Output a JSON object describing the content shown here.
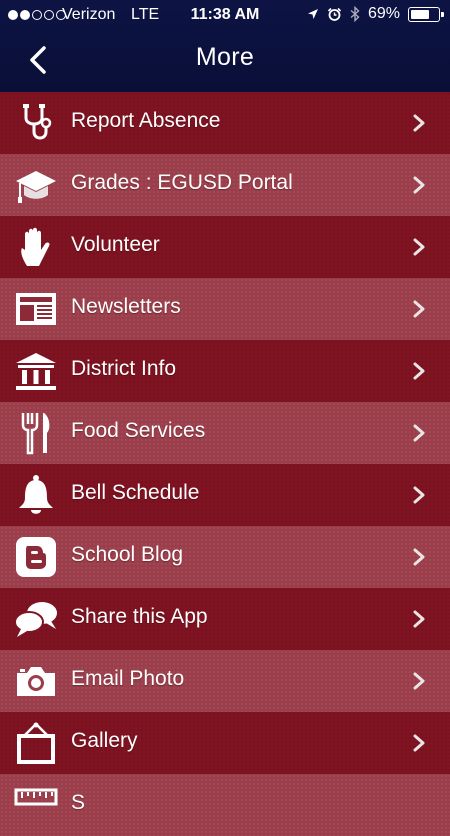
{
  "status_bar": {
    "signal_bars_filled": 2,
    "signal_bars_total": 5,
    "carrier": "Verizon",
    "network": "LTE",
    "time": "11:38 AM",
    "battery_percent": "69%",
    "battery_level": 0.69
  },
  "header": {
    "title": "More",
    "back_icon": "chevron-left-icon"
  },
  "menu": {
    "items": [
      {
        "label": "Report Absence",
        "icon": "stethoscope-icon"
      },
      {
        "label": "Grades : EGUSD Portal",
        "icon": "graduation-cap-icon"
      },
      {
        "label": "Volunteer",
        "icon": "hand-icon"
      },
      {
        "label": "Newsletters",
        "icon": "newspaper-icon"
      },
      {
        "label": "District Info",
        "icon": "bank-icon"
      },
      {
        "label": "Food Services",
        "icon": "fork-knife-icon"
      },
      {
        "label": "Bell Schedule",
        "icon": "bell-icon"
      },
      {
        "label": "School Blog",
        "icon": "blogger-icon"
      },
      {
        "label": "Share this App",
        "icon": "chat-bubbles-icon"
      },
      {
        "label": "Email Photo",
        "icon": "camera-icon"
      },
      {
        "label": "Gallery",
        "icon": "picture-frame-icon"
      },
      {
        "label": "S",
        "icon": "ruler-icon"
      }
    ]
  },
  "colors": {
    "nav_bar": "#0b1140",
    "row_dark": "#801322",
    "row_light": "#9b3d4a",
    "text": "#ffffff",
    "chevron": "#e9e4e6"
  }
}
